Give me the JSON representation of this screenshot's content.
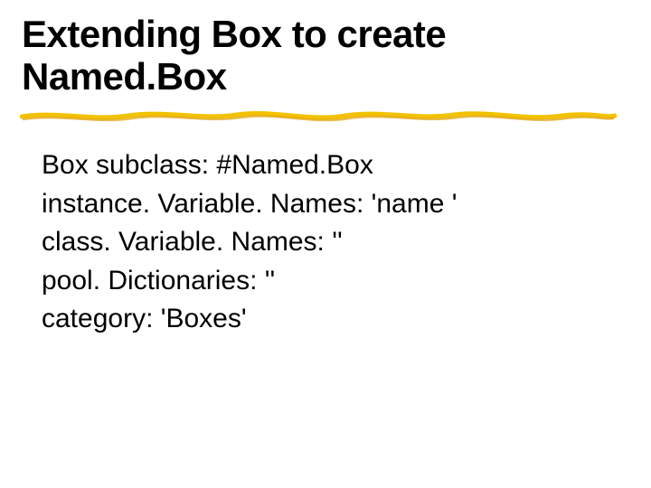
{
  "title": "Extending Box to create Named.Box",
  "body": {
    "lines": [
      "Box subclass: #Named.Box",
      "instance. Variable. Names: 'name '",
      "class. Variable. Names: ''",
      "pool. Dictionaries: ''",
      "category: 'Boxes'"
    ]
  }
}
